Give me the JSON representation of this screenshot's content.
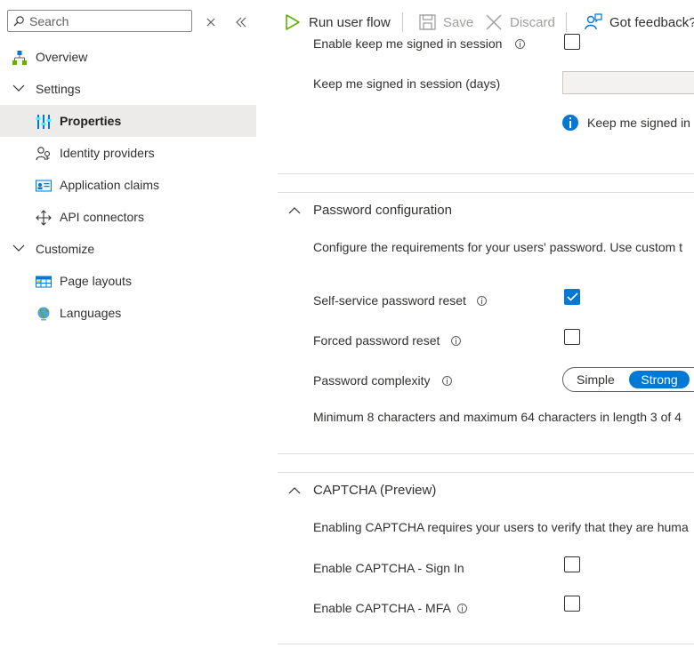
{
  "search": {
    "placeholder": "Search"
  },
  "nav": {
    "items": [
      {
        "label": "Overview"
      },
      {
        "label": "Settings"
      },
      {
        "label": "Properties"
      },
      {
        "label": "Identity providers"
      },
      {
        "label": "Application claims"
      },
      {
        "label": "API connectors"
      },
      {
        "label": "Customize"
      },
      {
        "label": "Page layouts"
      },
      {
        "label": "Languages"
      }
    ]
  },
  "toolbar": {
    "run_label": "Run user flow",
    "save_label": "Save",
    "discard_label": "Discard",
    "feedback_label": "Got feedback?"
  },
  "session": {
    "enable_label": "Enable keep me signed in session",
    "days_label": "Keep me signed in session (days)",
    "info_text": "Keep me signed in"
  },
  "password": {
    "title": "Password configuration",
    "description": "Configure the requirements for your users' password. Use custom t",
    "sspr_label": "Self-service password reset",
    "sspr_checked": true,
    "forced_label": "Forced password reset",
    "forced_checked": false,
    "complexity_label": "Password complexity",
    "complexity_options": [
      "Simple",
      "Strong"
    ],
    "complexity_selected": "Strong",
    "complexity_note": "Minimum 8 characters and maximum 64 characters in length 3 of 4"
  },
  "captcha": {
    "title": "CAPTCHA (Preview)",
    "description": "Enabling CAPTCHA requires your users to verify that they are huma",
    "signin_label": "Enable CAPTCHA - Sign In",
    "mfa_label": "Enable CAPTCHA - MFA"
  },
  "colors": {
    "accent": "#0078d4",
    "selected_bg": "#edebe9",
    "text": "#323130",
    "disabled": "#a19f9d"
  }
}
